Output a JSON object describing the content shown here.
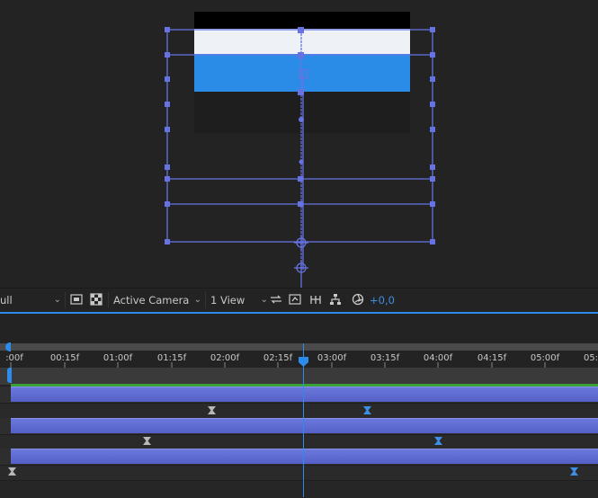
{
  "viewer": {
    "magnification": "Full",
    "magnification_visible": "ull",
    "camera": "Active Camera",
    "views": "1 View",
    "exposure_offset": "+0,0"
  },
  "timeline": {
    "ruler_labels": [
      ":00f",
      "00:15f",
      "01:00f",
      "01:15f",
      "02:00f",
      "02:15f",
      "03:00f",
      "03:15f",
      "04:00f",
      "04:15f",
      "05:00f",
      "05:"
    ],
    "current_time": "02:25f"
  },
  "colors": {
    "accent_blue": "#2d8ceb",
    "layer_bar": "#5e6ad2",
    "track_green": "#3aa03a",
    "comp_white": "#eef2f6",
    "comp_blue": "#2b8ce8",
    "comp_black": "#000000",
    "guide_blue": "#6673e0"
  },
  "icons": {
    "toggle_transparency": "checkerboard-icon",
    "region_of_interest": "roi-icon",
    "fast_previews": "fast-preview-icon",
    "toggle_3d_view": "3d-view-icon",
    "flowchart": "flowchart-icon",
    "reset_exposure": "exposure-icon"
  }
}
